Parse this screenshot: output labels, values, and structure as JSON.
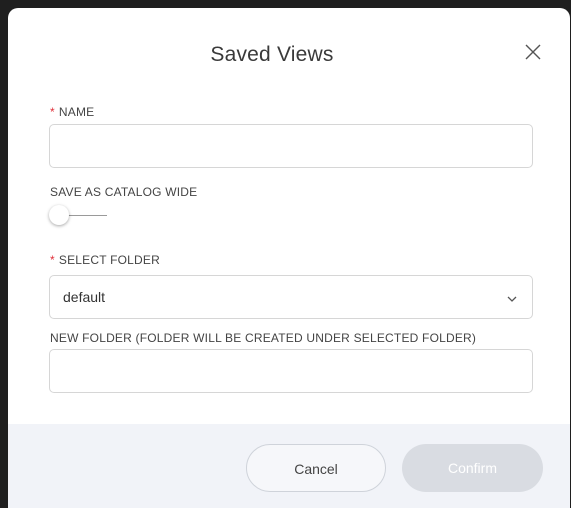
{
  "dialog": {
    "title": "Saved Views",
    "close_icon": "close-icon"
  },
  "fields": {
    "name": {
      "required_marker": "*",
      "label": "NAME",
      "value": ""
    },
    "catalog_wide": {
      "label": "SAVE AS CATALOG WIDE",
      "checked": false
    },
    "folder": {
      "required_marker": "*",
      "label": "SELECT FOLDER",
      "selected": "default",
      "icon": "chevron-down-icon"
    },
    "new_folder": {
      "label": "NEW FOLDER (FOLDER WILL BE CREATED UNDER SELECTED FOLDER)",
      "value": ""
    }
  },
  "footer": {
    "cancel_label": "Cancel",
    "confirm_label": "Confirm",
    "confirm_enabled": false
  },
  "colors": {
    "required": "#e0303a",
    "footer_bg": "#f1f3f8",
    "confirm_disabled_bg": "#d9dce2"
  }
}
